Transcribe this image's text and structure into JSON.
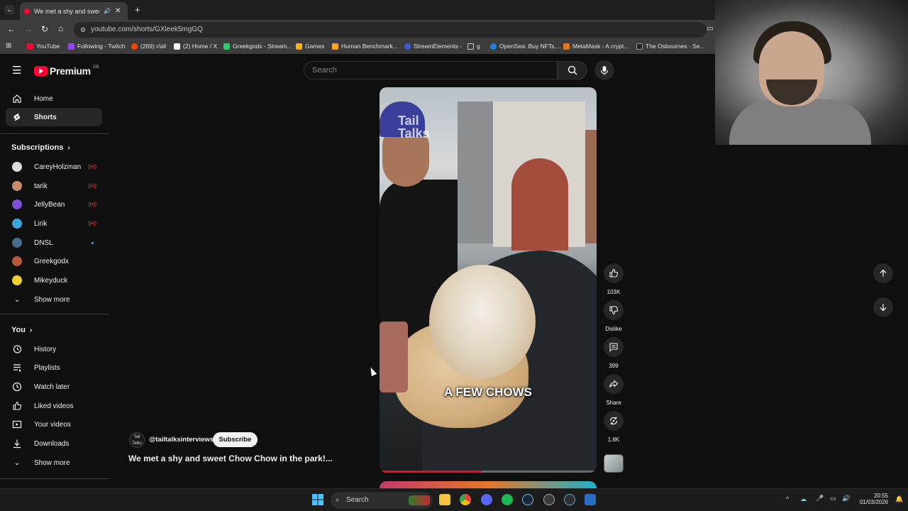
{
  "browser": {
    "tab_title": "We met a shy and sweet Ch",
    "url": "youtube.com/shorts/GXleek5mgGQ",
    "bookmarks": [
      "YouTube",
      "Following - Twitch",
      "(269) r/all",
      "(2) Home / X",
      "Greekgodx - Stream...",
      "Games",
      "Human Benchmark...",
      "StreamElements -",
      "g",
      "OpenSea: Buy NFTs,...",
      "MetaMask - A crypt...",
      "The Osbournes - Se..."
    ]
  },
  "header": {
    "logo_text": "Premium",
    "logo_region": "GB",
    "search_placeholder": "Search"
  },
  "sidebar": {
    "main": [
      {
        "label": "Home",
        "icon": "home-icon"
      },
      {
        "label": "Shorts",
        "icon": "shorts-icon"
      }
    ],
    "subscriptions_title": "Subscriptions",
    "subscriptions": [
      {
        "label": "CareyHolzman",
        "status": "live",
        "color": "#dcdcdc"
      },
      {
        "label": "tarik",
        "status": "live",
        "color": "#c98c6b"
      },
      {
        "label": "JellyBean",
        "status": "live",
        "color": "#7b4fd6"
      },
      {
        "label": "Lirik",
        "status": "live",
        "color": "#3aa7d6"
      },
      {
        "label": "DNSL",
        "status": "new",
        "color": "#4a6a8a"
      },
      {
        "label": "Greekgodx",
        "status": "",
        "color": "#b25a3a"
      },
      {
        "label": "Mikeyduck",
        "status": "",
        "color": "#f0d030"
      }
    ],
    "show_more": "Show more",
    "you_title": "You",
    "you_items": [
      {
        "label": "History",
        "icon": "history-icon"
      },
      {
        "label": "Playlists",
        "icon": "playlists-icon"
      },
      {
        "label": "Watch later",
        "icon": "clock-icon"
      },
      {
        "label": "Liked videos",
        "icon": "thumbs-up-icon"
      },
      {
        "label": "Your videos",
        "icon": "play-square-icon"
      },
      {
        "label": "Downloads",
        "icon": "download-icon"
      }
    ],
    "show_more_2": "Show more"
  },
  "short": {
    "watermark_line1": "Tail",
    "watermark_line2": "Talks",
    "caption": "A FEW CHOWS",
    "progress": 0.47,
    "channel_avatar_text": "Tail Talks",
    "channel": "@tailtalksinterviews",
    "subscribe": "Subscribe",
    "title": "We met a shy and sweet Chow Chow in the park!..."
  },
  "actions": {
    "likes": "103K",
    "dislike": "Dislike",
    "comments": "399",
    "share": "Share",
    "remix": "1.8K"
  },
  "taskbar": {
    "search": "Search",
    "time": "20:55",
    "date": "01/03/2026"
  }
}
